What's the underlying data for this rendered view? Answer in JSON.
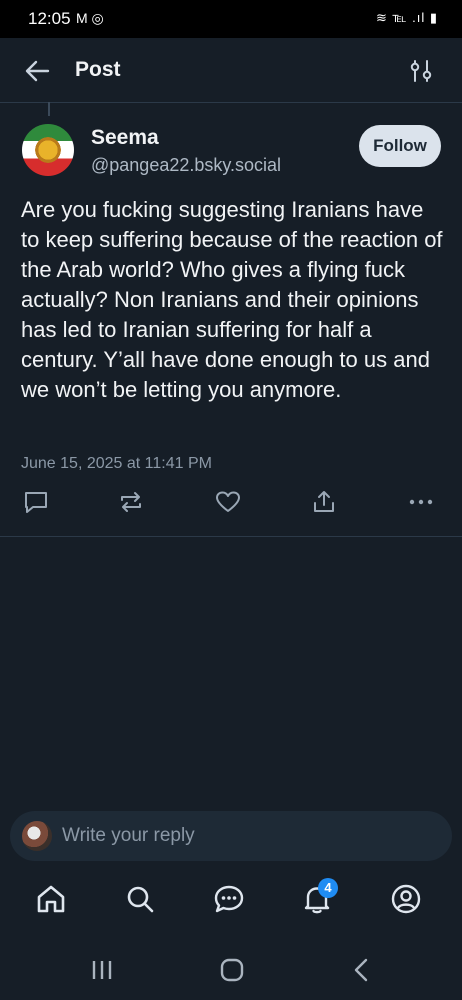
{
  "status_bar": {
    "time": "12:05",
    "notification_icons": "M ◎",
    "system_icons": "≋ ℡ .ıl ▮"
  },
  "header": {
    "title": "Post"
  },
  "post": {
    "author_name": "Seema",
    "author_handle": "@pangea22.bsky.social",
    "follow_label": "Follow",
    "text": "Are you fucking suggesting Iranians have to keep suffering because of the reaction of the Arab world? Who gives a flying fuck actually? Non Iranians and their opinions has led to Iranian suffering for half a century. Y’all have done enough to us and we won’t be letting you anymore.",
    "date": "June 15, 2025 at 11:41 PM"
  },
  "reply": {
    "placeholder": "Write your reply"
  },
  "bottom_nav": {
    "items": [
      "home-icon",
      "search-icon",
      "chat-icon",
      "notifications-icon",
      "profile-icon"
    ],
    "notification_count": "4"
  },
  "colors": {
    "background": "#161e27",
    "divider": "#2b3948",
    "follow_button": "#dbe3ec",
    "badge": "#1f8cf3",
    "muted_text": "#8b98a6"
  }
}
